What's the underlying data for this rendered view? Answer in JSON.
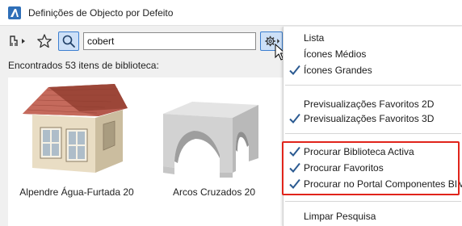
{
  "window": {
    "title": "Definições de Objecto por Defeito"
  },
  "toolbar": {
    "search_value": "cobert"
  },
  "results": {
    "found_label": "Encontrados 53 itens de biblioteca:",
    "items": [
      {
        "label": "Alpendre Água-Furtada 20"
      },
      {
        "label": "Arcos Cruzados 20"
      }
    ]
  },
  "menu": {
    "items": [
      {
        "label": "Lista",
        "checked": false
      },
      {
        "label": "Ícones Médios",
        "checked": false
      },
      {
        "label": "Ícones Grandes",
        "checked": true
      },
      {
        "label": "Previsualizações Favoritos 2D",
        "checked": false
      },
      {
        "label": "Previsualizações Favoritos 3D",
        "checked": true
      },
      {
        "label": "Procurar Biblioteca Activa",
        "checked": true
      },
      {
        "label": "Procurar Favoritos",
        "checked": true
      },
      {
        "label": "Procurar no Portal Componentes BIM",
        "checked": true
      },
      {
        "label": "Limpar Pesquisa",
        "checked": false
      }
    ]
  },
  "colors": {
    "accent": "#3c7fd0",
    "highlight": "#e0241b"
  }
}
